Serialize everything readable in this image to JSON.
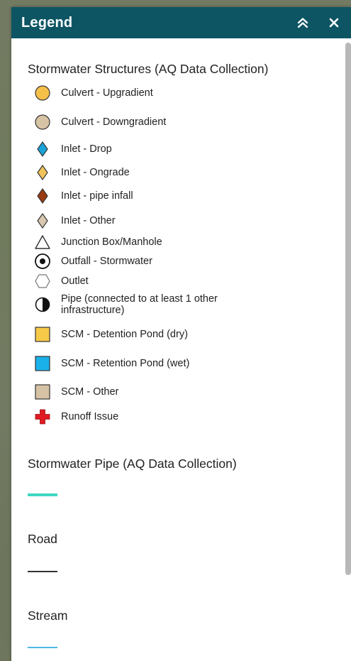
{
  "panel": {
    "title": "Legend",
    "collapse_icon": "double-chevron-up-icon",
    "close_icon": "close-icon"
  },
  "layers": {
    "structures": {
      "title": "Stormwater Structures (AQ Data Collection)",
      "items": [
        {
          "label": "Culvert - Upgradient",
          "symbol": "circle",
          "color": "#f5c04a"
        },
        {
          "label": "Culvert - Downgradient",
          "symbol": "circle",
          "color": "#d7c3a5"
        },
        {
          "label": "Inlet - Drop",
          "symbol": "diamond",
          "color": "#1aa3d9"
        },
        {
          "label": "Inlet - Ongrade",
          "symbol": "diamond",
          "color": "#f0c25a"
        },
        {
          "label": "Inlet - pipe infall",
          "symbol": "diamond",
          "color": "#9b3a12"
        },
        {
          "label": "Inlet - Other",
          "symbol": "diamond",
          "color": "#d9c7b0"
        },
        {
          "label": "Junction Box/Manhole",
          "symbol": "triangle",
          "color": "#ffffff"
        },
        {
          "label": "Outfall - Stormwater",
          "symbol": "target",
          "color": "#000000"
        },
        {
          "label": "Outlet",
          "symbol": "hexagon",
          "color": "#ffffff"
        },
        {
          "label": "Pipe (connected to at least 1 other infrastructure)",
          "symbol": "half-circle",
          "color": "#000000"
        },
        {
          "label": "SCM - Detention Pond (dry)",
          "symbol": "square",
          "color": "#f7c948"
        },
        {
          "label": "SCM - Retention Pond (wet)",
          "symbol": "square",
          "color": "#1ab1ea"
        },
        {
          "label": "SCM - Other",
          "symbol": "square",
          "color": "#d6c3a6"
        },
        {
          "label": "Runoff Issue",
          "symbol": "cross",
          "color": "#e01b22"
        }
      ]
    },
    "pipe": {
      "title": "Stormwater Pipe (AQ Data Collection)",
      "color": "#3fd8c4"
    },
    "road": {
      "title": "Road",
      "color": "#333333"
    },
    "stream": {
      "title": "Stream",
      "color": "#4fb6e6"
    }
  }
}
